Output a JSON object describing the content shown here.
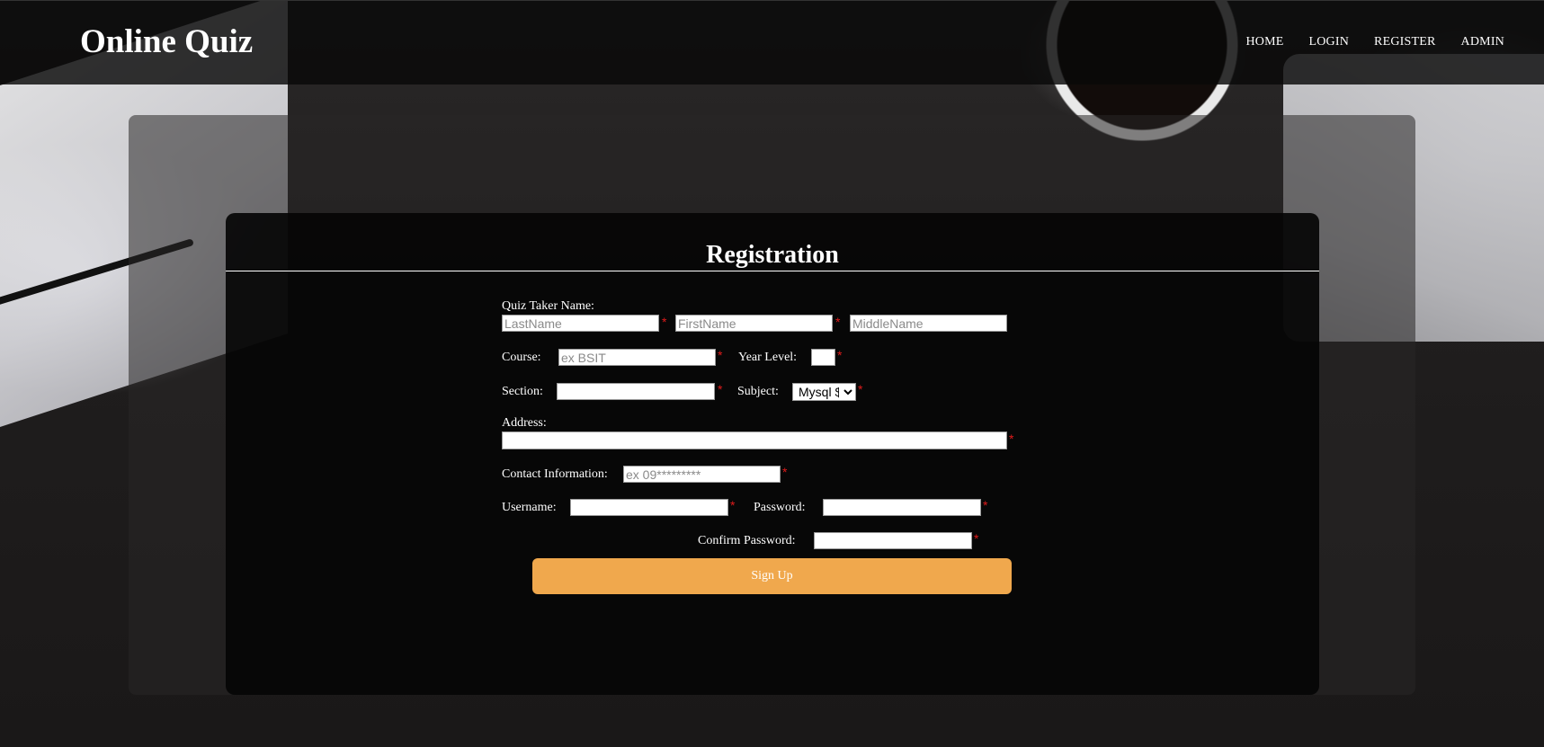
{
  "header": {
    "brand": "Online Quiz",
    "nav": [
      "HOME",
      "LOGIN",
      "REGISTER",
      "ADMIN"
    ]
  },
  "form": {
    "title": "Registration",
    "name_label": "Quiz Taker Name:",
    "lastname_placeholder": "LastName",
    "firstname_placeholder": "FirstName",
    "middlename_placeholder": "MiddleName",
    "course_label": "Course:",
    "course_placeholder": "ex BSIT",
    "year_label": "Year Level:",
    "section_label": "Section:",
    "subject_label": "Subject:",
    "subject_selected": "Mysql $",
    "address_label": "Address:",
    "contact_label": "Contact Information:",
    "contact_placeholder": "ex 09*********",
    "username_label": "Username:",
    "password_label": "Password:",
    "confirm_label": "Confirm Password:",
    "required_mark": "*",
    "submit_label": "Sign Up"
  },
  "colors": {
    "accent": "#f0a84d",
    "required": "#e01b1b"
  }
}
